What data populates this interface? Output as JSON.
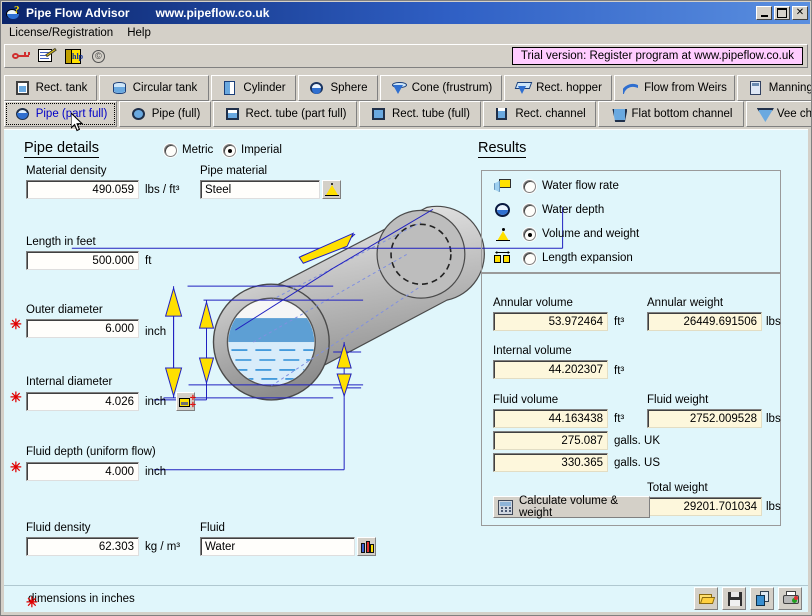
{
  "window": {
    "title": "Pipe Flow Advisor",
    "url": "www.pipeflow.co.uk",
    "minimize": "_",
    "maximize": "□",
    "close": "✕"
  },
  "menu": {
    "items": [
      {
        "label": "License/Registration"
      },
      {
        "label": "Help"
      }
    ]
  },
  "toolbar": {
    "buttons": [
      {
        "icon": "key-icon",
        "label": "License key"
      },
      {
        "icon": "register-icon",
        "label": "Register"
      },
      {
        "icon": "help-book-icon",
        "label": "Help"
      },
      {
        "icon": "copyright-icon",
        "label": "About"
      }
    ]
  },
  "trial_banner": "Trial version: Register program at www.pipeflow.co.uk",
  "tabs_row1": [
    {
      "label": "Rect. tank",
      "icon": "rect-tank-icon",
      "active": false
    },
    {
      "label": "Circular tank",
      "icon": "circular-tank-icon",
      "active": false
    },
    {
      "label": "Cylinder",
      "icon": "cylinder-icon",
      "active": false
    },
    {
      "label": "Sphere",
      "icon": "sphere-icon",
      "active": false
    },
    {
      "label": "Cone (frustrum)",
      "icon": "cone-icon",
      "active": false
    },
    {
      "label": "Rect. hopper",
      "icon": "rect-hopper-icon",
      "active": false
    },
    {
      "label": "Flow from Weirs",
      "icon": "weir-icon",
      "active": false
    },
    {
      "label": "Manning calculator",
      "icon": "manning-icon",
      "active": false
    }
  ],
  "tabs_row2": [
    {
      "label": "Pipe (part full)",
      "icon": "pipe-part-full-icon",
      "active": true
    },
    {
      "label": "Pipe (full)",
      "icon": "pipe-full-icon",
      "active": false
    },
    {
      "label": "Rect. tube (part full)",
      "icon": "rect-tube-part-full-icon",
      "active": false
    },
    {
      "label": "Rect. tube (full)",
      "icon": "rect-tube-full-icon",
      "active": false
    },
    {
      "label": "Rect. channel",
      "icon": "rect-channel-icon",
      "active": false
    },
    {
      "label": "Flat bottom channel",
      "icon": "flat-bottom-channel-icon",
      "active": false
    },
    {
      "label": "Vee channel",
      "icon": "vee-channel-icon",
      "active": false
    }
  ],
  "pipe_details": {
    "section_title": "Pipe details",
    "units": {
      "metric_label": "Metric",
      "imperial_label": "Imperial",
      "selected": "Imperial"
    },
    "material_density": {
      "label": "Material density",
      "value": "490.059",
      "unit": "lbs / ft³"
    },
    "pipe_material": {
      "label": "Pipe material",
      "value": "Steel",
      "picker_icon": "material-picker-icon"
    },
    "length": {
      "label": "Length  in feet",
      "value": "500.000",
      "unit": "ft"
    },
    "outer_diameter": {
      "label": "Outer diameter",
      "value": "6.000",
      "unit": "inch",
      "required": true
    },
    "internal_diameter": {
      "label": "Internal diameter",
      "value": "4.026",
      "unit": "inch",
      "required": true,
      "picker_icon": "size-picker-icon"
    },
    "fluid_depth": {
      "label": "Fluid depth (uniform flow)",
      "value": "4.000",
      "unit": "inch",
      "required": true
    },
    "fluid_density": {
      "label": "Fluid density",
      "value": "62.303",
      "unit": "kg / m³"
    },
    "fluid": {
      "label": "Fluid",
      "value": "Water",
      "picker_icon": "fluid-picker-icon"
    }
  },
  "results": {
    "section_title": "Results",
    "modes": [
      {
        "label": "Water flow rate",
        "icon": "water-flow-rate-icon",
        "selected": false
      },
      {
        "label": "Water depth",
        "icon": "water-depth-icon",
        "selected": false
      },
      {
        "label": "Volume and weight",
        "icon": "volume-weight-icon",
        "selected": true
      },
      {
        "label": "Length expansion",
        "icon": "length-expansion-icon",
        "selected": false
      }
    ],
    "annular_volume": {
      "label": "Annular volume",
      "value": "53.972464",
      "unit": "ft³"
    },
    "annular_weight": {
      "label": "Annular weight",
      "value": "26449.691506",
      "unit": "lbs"
    },
    "internal_volume": {
      "label": "Internal volume",
      "value": "44.202307",
      "unit": "ft³"
    },
    "fluid_volume": {
      "label": "Fluid volume",
      "rows": [
        {
          "value": "44.163438",
          "unit": "ft³"
        },
        {
          "value": "275.087",
          "unit": "galls. UK"
        },
        {
          "value": "330.365",
          "unit": "galls. US"
        }
      ]
    },
    "fluid_weight": {
      "label": "Fluid weight",
      "value": "2752.009528",
      "unit": "lbs"
    },
    "total_weight": {
      "label": "Total weight",
      "value": "29201.701034",
      "unit": "lbs"
    },
    "calculate_button": {
      "label": "Calculate volume & weight",
      "icon": "calculator-icon"
    }
  },
  "statusbar": {
    "note": "dimensions in inches",
    "buttons": [
      {
        "icon": "open-icon",
        "label": "Open"
      },
      {
        "icon": "save-icon",
        "label": "Save"
      },
      {
        "icon": "copy-icon",
        "label": "Copy"
      },
      {
        "icon": "print-icon",
        "label": "Print"
      }
    ]
  },
  "colors": {
    "panel_bg": "#e0f6fb",
    "chrome": "#d4d0c8",
    "title_start": "#0a246a",
    "result_field": "#fdf7dc",
    "trial_bg": "#ffccff",
    "accent_link": "#0000c8",
    "required_star": "#e00000"
  }
}
